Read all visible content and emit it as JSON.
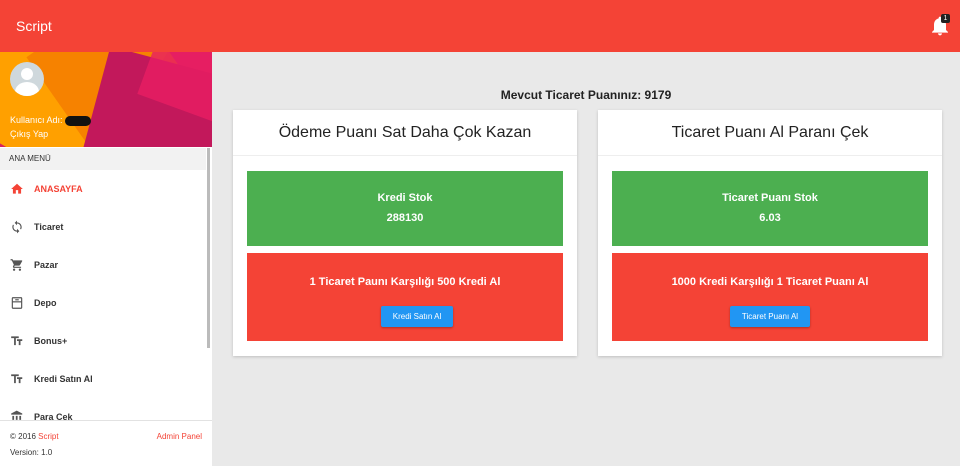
{
  "topbar": {
    "brand": "Script",
    "notification_count": "1"
  },
  "sidebar": {
    "username_label": "Kullanıcı Adı:",
    "logout_label": "Çıkış Yap",
    "menu_header": "ANA MENÜ",
    "items": [
      {
        "label": "ANASAYFA",
        "icon": "home-icon",
        "active": true
      },
      {
        "label": "Ticaret",
        "icon": "sync-icon"
      },
      {
        "label": "Pazar",
        "icon": "cart-icon"
      },
      {
        "label": "Depo",
        "icon": "storage-icon"
      },
      {
        "label": "Bonus+",
        "icon": "text-icon"
      },
      {
        "label": "Kredi Satın Al",
        "icon": "text-icon"
      },
      {
        "label": "Para Çek",
        "icon": "bank-icon"
      }
    ],
    "footer": {
      "copyright_prefix": "© 2016",
      "copyright_brand": "Script",
      "admin_link": "Admin Panel",
      "version": "Version: 1.0"
    }
  },
  "main": {
    "points_title": "Mevcut Ticaret Puanınız: 9179",
    "cards": [
      {
        "title": "Ödeme Puanı Sat Daha Çok Kazan",
        "stock_label": "Kredi Stok",
        "stock_value": "288130",
        "offer_text": "1 Ticaret Paunı Karşılığı 500 Kredi Al",
        "button_label": "Kredi Satın Al"
      },
      {
        "title": "Ticaret Puanı Al Paranı Çek",
        "stock_label": "Ticaret Puanı Stok",
        "stock_value": "6.03",
        "offer_text": "1000 Kredi Karşılığı 1 Ticaret Puanı Al",
        "button_label": "Ticaret Puanı Al"
      }
    ]
  },
  "colors": {
    "primary": "#f44336",
    "success": "#4caf50",
    "button": "#2196f3"
  }
}
